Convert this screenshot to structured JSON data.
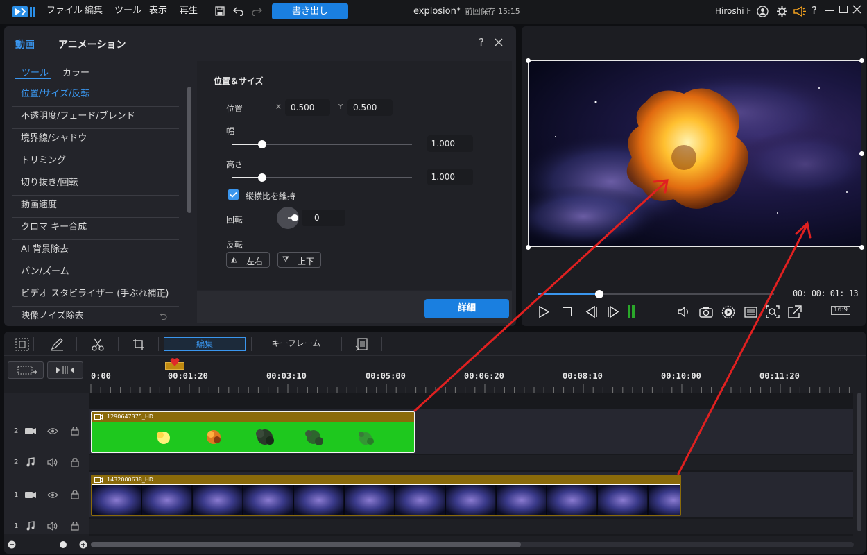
{
  "app": {
    "title": "explosion*",
    "save_status": "前回保存 15:15",
    "user": "Hiroshi F"
  },
  "menu": [
    "ファイル",
    "編集",
    "ツール",
    "表示",
    "再生"
  ],
  "toolbar": {
    "export_label": "書き出し"
  },
  "left_panel": {
    "tabs": [
      "動画",
      "アニメーション"
    ],
    "subtabs": [
      "ツール",
      "カラー"
    ],
    "tools": [
      "位置/サイズ/反転",
      "不透明度/フェード/ブレンド",
      "境界線/シャドウ",
      "トリミング",
      "切り抜き/回転",
      "動画速度",
      "クロマ キー合成",
      "AI 背景除去",
      "パン/ズーム",
      "ビデオ スタビライザー (手ぶれ補正)",
      "映像ノイズ除去"
    ],
    "active_tool_index": 0,
    "section_title": "位置＆サイズ",
    "position_label": "位置",
    "x_label": "X",
    "x_value": "0.500",
    "y_label": "Y",
    "y_value": "0.500",
    "width_label": "幅",
    "width_value": "1.000",
    "height_label": "高さ",
    "height_value": "1.000",
    "keep_ratio_label": "縦横比を維持",
    "keep_ratio_checked": true,
    "rotation_label": "回転",
    "rotation_value": "0",
    "flip_label": "反転",
    "flip_h_label": "左右",
    "flip_v_label": "上下",
    "detail_button": "詳細",
    "width_slider_fraction": 0.17,
    "height_slider_fraction": 0.17
  },
  "preview": {
    "timecode": "00: 00: 01: 13",
    "aspect": "16:9",
    "progress_fraction": 0.26
  },
  "timeline": {
    "tabs": [
      "編集",
      "キーフレーム"
    ],
    "ruler": [
      "0:00",
      "00:01:20",
      "00:03:10",
      "00:05:00",
      "00:06:20",
      "00:08:10",
      "00:10:00",
      "00:11:20"
    ],
    "tracks": [
      {
        "number": "2",
        "type": "video"
      },
      {
        "number": "2",
        "type": "audio"
      },
      {
        "number": "1",
        "type": "video"
      },
      {
        "number": "1",
        "type": "audio"
      }
    ],
    "clips": [
      {
        "name": "1290647375_HD",
        "track": "2"
      },
      {
        "name": "1432000638_HD",
        "track": "1"
      }
    ]
  },
  "colors": {
    "accent": "#1a7fe0",
    "clip_header": "#8a6a0a",
    "chroma_green": "#1ec81e",
    "annotation_arrow": "#e02020"
  }
}
